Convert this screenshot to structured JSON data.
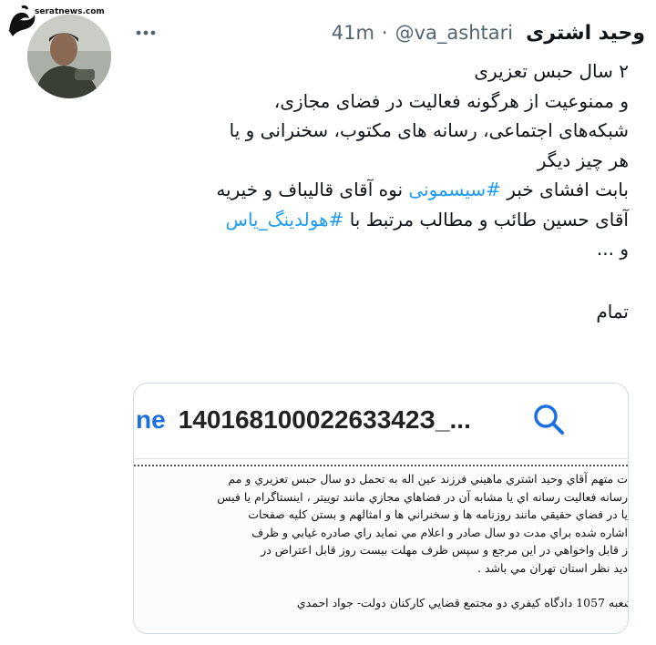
{
  "watermark": {
    "site": "seratnews.com",
    "logo_text": "صراط"
  },
  "tweet": {
    "author_name": "وحید اشتری",
    "handle": "@va_ashtari",
    "separator": "·",
    "time": "41m",
    "more_icon": "more-horizontal-icon",
    "text_lines": [
      "۲ سال حبس تعزیری",
      "و ممنوعیت از هرگونه فعالیت در فضای مجازی،",
      "شبکه‌های اجتماعی، رسانه های مکتوب، سخنرانی و یا",
      "هر چیز دیگر"
    ],
    "line5": {
      "before": "بابت افشای خبر ",
      "hashtag": "#سیسمونی",
      "after": " نوه آقای قالیباف و خیریه"
    },
    "line6": {
      "before": "آقای حسین طائب و مطالب مرتبط با ",
      "hashtag": "#هولدینگ_یاس"
    },
    "line7": "و ...",
    "closing": "تمام"
  },
  "media": {
    "search": {
      "prefix": "ne",
      "query": "14016810002263342З_...",
      "icon": "search-icon",
      "accent_color": "#1b6fe0"
    },
    "document_lines": [
      "ت متهم آقاي وحيد اشتري ماهيني  فرزند عين اله به تحمل دو سال حبس تعزيري و مم",
      "رسانه فعاليت رسانه اي يا مشابه آن  در فضاهاي مجازي مانند توييتر ، اينستاگرام يا فيس",
      "يا در فضاي حقيقي مانند روزنامه ها و سخنراني ها و امثالهم و بستن كليه صفحات",
      "اشاره شده  براي مدت دو سال  صادر و اعلام مي نمايد راي صادره غيابي و ظرف",
      "ز قابل واخواهي در اين مرجع و سپس ظرف مهلت  بيست  روز قابل اعتراض در",
      "ديد نظر استان تهران مي باشد ."
    ],
    "signature": "شعبه 1057  دادگاه كيفري دو مجتمع قضايي كاركنان دولت- جواد احمدي"
  }
}
